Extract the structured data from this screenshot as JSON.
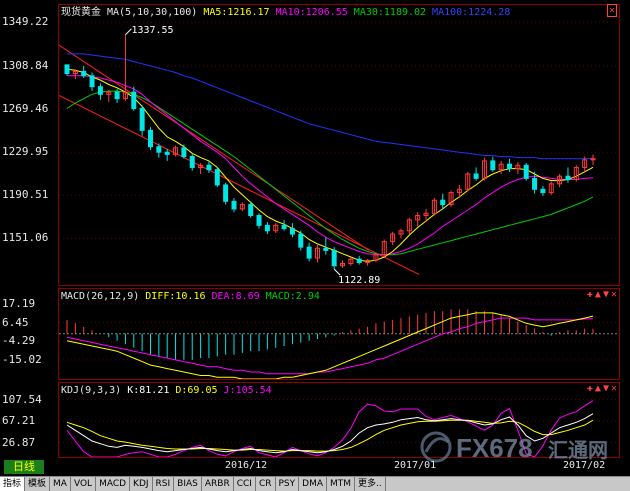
{
  "price": {
    "title": "现货黄金",
    "ma_title": "MA(5,10,30,100)",
    "ma5": "MA5:1216.17",
    "ma10": "MA10:1206.55",
    "ma30": "MA30:1189.02",
    "ma100": "MA100:1224.28",
    "y_ticks": [
      "1349.22",
      "1308.84",
      "1269.46",
      "1229.95",
      "1190.51",
      "1151.06"
    ],
    "high_label": "1337.55",
    "low_label": "1122.89"
  },
  "macd": {
    "title": "MACD(26,12,9)",
    "diff": "DIFF:10.16",
    "dea": "DEA:8.69",
    "macd": "MACD:2.94",
    "y_ticks": [
      "17.19",
      "6.45",
      "-4.29",
      "-15.02"
    ]
  },
  "kdj": {
    "title": "KDJ(9,3,3)",
    "k": "K:81.21",
    "d": "D:69.05",
    "j": "J:105.54",
    "y_ticks": [
      "107.54",
      "67.21",
      "26.87"
    ]
  },
  "time_axis": {
    "labels": [
      "2016/12",
      "2017/01",
      "2017/02"
    ]
  },
  "period": "日线",
  "indicator_tabs": [
    "指标",
    "模板",
    "MA",
    "VOL",
    "MACD",
    "KDJ",
    "RSI",
    "BIAS",
    "ARBR",
    "CCI",
    "CR",
    "PSY",
    "DMA",
    "MTM",
    "更多.."
  ],
  "panel_controls": {
    "up": "▲",
    "down": "▼",
    "close": "✕",
    "plus": "✚"
  },
  "watermark": {
    "brand": "FX678",
    "cn": "汇通网"
  },
  "colors": {
    "background": "#000000",
    "up_candle": "#ff3b3b",
    "down_candle": "#00e6e6",
    "ma5": "#ffff00",
    "ma10": "#ff00ff",
    "ma30": "#00cc00",
    "ma100": "#2233ff",
    "channel": "#ff2020",
    "diff": "#ffff00",
    "dea": "#ff00ff",
    "k": "#ffffff",
    "d": "#ffff00",
    "j": "#ff00ff"
  },
  "chart_data": [
    {
      "type": "candlestick",
      "ylim": [
        1112,
        1352
      ],
      "candles": [
        [
          1310,
          1310,
          1300,
          1302
        ],
        [
          1302,
          1306,
          1297,
          1304
        ],
        [
          1304,
          1309,
          1298,
          1300
        ],
        [
          1300,
          1303,
          1286,
          1290
        ],
        [
          1290,
          1293,
          1278,
          1283
        ],
        [
          1283,
          1287,
          1276,
          1285
        ],
        [
          1285,
          1288,
          1275,
          1279
        ],
        [
          1279,
          1337.55,
          1277,
          1285
        ],
        [
          1285,
          1290,
          1268,
          1270
        ],
        [
          1270,
          1273,
          1245,
          1250
        ],
        [
          1250,
          1253,
          1232,
          1235
        ],
        [
          1235,
          1238,
          1225,
          1230
        ],
        [
          1230,
          1233,
          1222,
          1228
        ],
        [
          1228,
          1236,
          1226,
          1234
        ],
        [
          1234,
          1237,
          1224,
          1226
        ],
        [
          1226,
          1229,
          1213,
          1216
        ],
        [
          1216,
          1220,
          1210,
          1218
        ],
        [
          1218,
          1222,
          1211,
          1214
        ],
        [
          1214,
          1216,
          1198,
          1200
        ],
        [
          1200,
          1202,
          1182,
          1185
        ],
        [
          1185,
          1188,
          1175,
          1178
        ],
        [
          1178,
          1184,
          1176,
          1182
        ],
        [
          1182,
          1185,
          1170,
          1172
        ],
        [
          1172,
          1174,
          1160,
          1163
        ],
        [
          1163,
          1166,
          1155,
          1158
        ],
        [
          1158,
          1165,
          1156,
          1163
        ],
        [
          1163,
          1168,
          1158,
          1160
        ],
        [
          1160,
          1165,
          1152,
          1155
        ],
        [
          1155,
          1158,
          1140,
          1143
        ],
        [
          1143,
          1147,
          1130,
          1133
        ],
        [
          1133,
          1145,
          1129,
          1142
        ],
        [
          1142,
          1152,
          1136,
          1140
        ],
        [
          1140,
          1143,
          1122.89,
          1126
        ],
        [
          1126,
          1131,
          1124,
          1128
        ],
        [
          1128,
          1134,
          1126,
          1132
        ],
        [
          1132,
          1135,
          1127,
          1129
        ],
        [
          1129,
          1132,
          1126,
          1131
        ],
        [
          1131,
          1138,
          1129,
          1136
        ],
        [
          1136,
          1150,
          1134,
          1148
        ],
        [
          1148,
          1157,
          1145,
          1155
        ],
        [
          1155,
          1160,
          1151,
          1158
        ],
        [
          1158,
          1170,
          1155,
          1168
        ],
        [
          1168,
          1175,
          1162,
          1172
        ],
        [
          1172,
          1178,
          1166,
          1174
        ],
        [
          1174,
          1188,
          1172,
          1186
        ],
        [
          1186,
          1192,
          1178,
          1182
        ],
        [
          1182,
          1195,
          1180,
          1193
        ],
        [
          1193,
          1200,
          1188,
          1196
        ],
        [
          1196,
          1212,
          1194,
          1210
        ],
        [
          1210,
          1216,
          1204,
          1206
        ],
        [
          1206,
          1225,
          1204,
          1222
        ],
        [
          1222,
          1226,
          1212,
          1214
        ],
        [
          1214,
          1222,
          1210,
          1219
        ],
        [
          1219,
          1224,
          1212,
          1215
        ],
        [
          1215,
          1221,
          1210,
          1218
        ],
        [
          1218,
          1220,
          1204,
          1206
        ],
        [
          1206,
          1212,
          1192,
          1196
        ],
        [
          1196,
          1199,
          1190,
          1193
        ],
        [
          1193,
          1203,
          1191,
          1201
        ],
        [
          1201,
          1210,
          1198,
          1208
        ],
        [
          1208,
          1216,
          1202,
          1205
        ],
        [
          1205,
          1218,
          1203,
          1216
        ],
        [
          1216,
          1226,
          1212,
          1223
        ],
        [
          1223,
          1228,
          1218,
          1224
        ]
      ],
      "ma5": [
        1306,
        1305,
        1303,
        1299,
        1296,
        1292,
        1289,
        1285,
        1280,
        1272,
        1262,
        1252,
        1244,
        1240,
        1235,
        1229,
        1225,
        1222,
        1216,
        1207,
        1198,
        1191,
        1184,
        1177,
        1171,
        1167,
        1164,
        1160,
        1156,
        1150,
        1146,
        1143,
        1140,
        1137,
        1134,
        1131,
        1130,
        1131,
        1134,
        1139,
        1146,
        1154,
        1161,
        1167,
        1173,
        1178,
        1184,
        1189,
        1195,
        1200,
        1206,
        1210,
        1213,
        1215,
        1215,
        1214,
        1210,
        1206,
        1204,
        1204,
        1205,
        1208,
        1212,
        1216.17
      ],
      "ma10": [
        1300,
        1300,
        1300,
        1299,
        1298,
        1296,
        1294,
        1291,
        1288,
        1283,
        1276,
        1270,
        1264,
        1258,
        1252,
        1246,
        1240,
        1235,
        1230,
        1224,
        1216,
        1208,
        1201,
        1195,
        1189,
        1183,
        1178,
        1173,
        1168,
        1163,
        1157,
        1152,
        1148,
        1145,
        1142,
        1139,
        1137,
        1136,
        1136,
        1137,
        1139,
        1142,
        1146,
        1151,
        1156,
        1162,
        1167,
        1172,
        1177,
        1182,
        1188,
        1193,
        1198,
        1202,
        1205,
        1207,
        1208,
        1207,
        1206,
        1205,
        1205,
        1205,
        1206,
        1206.55
      ],
      "ma30": [
        1270,
        1275,
        1279,
        1283,
        1285,
        1286,
        1286,
        1285,
        1283,
        1280,
        1276,
        1271,
        1266,
        1261,
        1256,
        1251,
        1246,
        1241,
        1236,
        1231,
        1226,
        1220,
        1214,
        1208,
        1202,
        1196,
        1190,
        1184,
        1178,
        1172,
        1166,
        1160,
        1155,
        1150,
        1146,
        1142,
        1139,
        1137,
        1136,
        1136,
        1137,
        1139,
        1141,
        1143,
        1145,
        1147,
        1149,
        1151,
        1153,
        1155,
        1157,
        1159,
        1161,
        1163,
        1165,
        1167,
        1169,
        1171,
        1173,
        1176,
        1179,
        1182,
        1185,
        1189.02
      ],
      "ma100": [
        1320,
        1320,
        1320,
        1319,
        1318,
        1317,
        1316,
        1315,
        1313,
        1311,
        1309,
        1307,
        1305,
        1303,
        1300,
        1298,
        1295,
        1292,
        1289,
        1286,
        1283,
        1280,
        1277,
        1274,
        1271,
        1268,
        1265,
        1262,
        1259,
        1256,
        1254,
        1252,
        1250,
        1248,
        1246,
        1244,
        1242,
        1240,
        1239,
        1238,
        1237,
        1236,
        1235,
        1234,
        1233,
        1232,
        1231,
        1230,
        1229,
        1228,
        1227,
        1227,
        1226,
        1226,
        1225,
        1225,
        1225,
        1224,
        1224,
        1224,
        1224,
        1224,
        1224,
        1224.28
      ]
    },
    {
      "type": "bar",
      "ylim": [
        -26,
        20
      ],
      "macd": [
        8,
        6,
        4,
        2,
        0,
        -2,
        -4,
        -6,
        -8,
        -10,
        -12,
        -13,
        -14,
        -15,
        -15,
        -15,
        -14,
        -14,
        -13,
        -12,
        -12,
        -11,
        -10,
        -10,
        -9,
        -8,
        -7,
        -6,
        -5,
        -4,
        -3,
        -2,
        -1,
        1,
        2,
        3,
        4,
        6,
        7,
        8,
        9,
        10,
        11,
        12,
        13,
        13,
        14,
        14,
        14,
        13,
        13,
        12,
        11,
        9,
        7,
        5,
        3,
        1,
        -1,
        1,
        2,
        2,
        3,
        2.94
      ],
      "diff": [
        -4,
        -5,
        -6,
        -7,
        -8,
        -9,
        -10,
        -12,
        -14,
        -16,
        -18,
        -19,
        -20,
        -21,
        -22,
        -23,
        -24,
        -24,
        -25,
        -25,
        -25,
        -26,
        -26,
        -26,
        -26,
        -26,
        -25,
        -25,
        -24,
        -23,
        -22,
        -21,
        -19,
        -17,
        -15,
        -13,
        -11,
        -9,
        -7,
        -5,
        -3,
        -1,
        1,
        3,
        5,
        7,
        9,
        10,
        11,
        12,
        12,
        12,
        11,
        10,
        8,
        6,
        5,
        4,
        5,
        6,
        7,
        8,
        9,
        10.16
      ],
      "dea": [
        -2,
        -3,
        -4,
        -5,
        -6,
        -7,
        -8,
        -9,
        -10,
        -11,
        -12,
        -13,
        -14,
        -15,
        -16,
        -17,
        -18,
        -19,
        -19,
        -20,
        -21,
        -21,
        -22,
        -22,
        -23,
        -23,
        -23,
        -23,
        -23,
        -23,
        -22,
        -22,
        -21,
        -20,
        -19,
        -18,
        -17,
        -15,
        -14,
        -12,
        -10,
        -8,
        -6,
        -4,
        -2,
        0,
        1,
        3,
        4,
        6,
        7,
        8,
        9,
        9,
        9,
        9,
        8,
        8,
        8,
        8,
        8,
        8,
        8.5,
        8.69
      ]
    },
    {
      "type": "line",
      "ylim": [
        0,
        120
      ],
      "k": [
        60,
        50,
        40,
        30,
        25,
        20,
        18,
        22,
        20,
        18,
        15,
        12,
        10,
        12,
        14,
        16,
        18,
        15,
        12,
        10,
        12,
        14,
        16,
        12,
        10,
        8,
        10,
        14,
        12,
        10,
        8,
        10,
        14,
        20,
        30,
        45,
        55,
        60,
        62,
        65,
        70,
        72,
        74,
        70,
        68,
        70,
        72,
        70,
        68,
        64,
        60,
        62,
        70,
        75,
        60,
        40,
        30,
        35,
        45,
        55,
        60,
        65,
        72,
        81.21
      ],
      "d": [
        65,
        60,
        55,
        48,
        40,
        35,
        30,
        28,
        25,
        22,
        20,
        18,
        16,
        15,
        15,
        15,
        16,
        16,
        15,
        14,
        13,
        13,
        14,
        14,
        13,
        12,
        11,
        12,
        12,
        12,
        11,
        11,
        12,
        14,
        18,
        25,
        33,
        42,
        50,
        55,
        60,
        63,
        66,
        67,
        67,
        68,
        69,
        69,
        69,
        67,
        65,
        63,
        64,
        67,
        65,
        57,
        48,
        42,
        42,
        46,
        50,
        55,
        60,
        69.05
      ],
      "j": [
        50,
        30,
        10,
        0,
        0,
        0,
        0,
        5,
        8,
        10,
        5,
        0,
        0,
        5,
        12,
        18,
        22,
        12,
        5,
        2,
        10,
        16,
        20,
        8,
        4,
        0,
        8,
        18,
        12,
        6,
        2,
        8,
        18,
        32,
        54,
        85,
        99,
        96,
        86,
        85,
        90,
        90,
        90,
        76,
        70,
        74,
        78,
        72,
        66,
        58,
        50,
        60,
        82,
        91,
        50,
        6,
        0,
        21,
        51,
        73,
        80,
        85,
        96,
        105.54
      ]
    }
  ]
}
